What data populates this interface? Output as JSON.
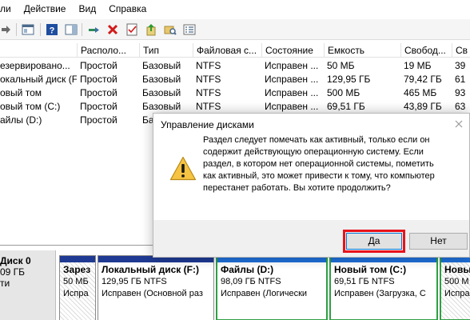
{
  "menu": [
    "Действие",
    "Вид",
    "Справка"
  ],
  "menu_partial": "ли",
  "columns": [
    "Располо...",
    "Тип",
    "Файловая с...",
    "Состояние",
    "Емкость",
    "Свобод...",
    "Св"
  ],
  "volumes": [
    {
      "name": "езервировано...",
      "layout": "Простой",
      "type": "Базовый",
      "fs": "NTFS",
      "status": "Исправен ...",
      "capacity": "50 МБ",
      "free": "19 МБ",
      "pct": "39"
    },
    {
      "name": "окальный диск (F:)",
      "layout": "Простой",
      "type": "Базовый",
      "fs": "NTFS",
      "status": "Исправен ...",
      "capacity": "129,95 ГБ",
      "free": "79,42 ГБ",
      "pct": "61"
    },
    {
      "name": "овый том",
      "layout": "Простой",
      "type": "Базовый",
      "fs": "NTFS",
      "status": "Исправен ...",
      "capacity": "500 МБ",
      "free": "465 МБ",
      "pct": "93"
    },
    {
      "name": "овый том (C:)",
      "layout": "Простой",
      "type": "Базовый",
      "fs": "NTFS",
      "status": "Исправен ...",
      "capacity": "69,51 ГБ",
      "free": "43,89 ГБ",
      "pct": "63"
    },
    {
      "name": "айлы (D:)",
      "layout": "Простой",
      "type": "Ба",
      "fs": "",
      "status": "",
      "capacity": "",
      "free": "",
      "pct": ""
    }
  ],
  "disk": {
    "title": "Диск 0",
    "line2": "09 ГБ",
    "line3": "ти"
  },
  "partitions": [
    {
      "name": "Зарез",
      "size": "50 МБ",
      "status": "Испра"
    },
    {
      "name": "Локальный диск (F:)",
      "size": "129,95 ГБ NTFS",
      "status": "Исправен (Основной раз"
    },
    {
      "name": "Файлы (D:)",
      "size": "98,09 ГБ NTFS",
      "status": "Исправен (Логически"
    },
    {
      "name": "Новый том (C:)",
      "size": "69,51 ГБ NTFS",
      "status": "Исправен (Загрузка, С"
    },
    {
      "name": "Новы",
      "size": "500 М",
      "status": "Испра"
    }
  ],
  "dialog": {
    "title": "Управление дисками",
    "message": [
      "Раздел следует помечать как активный, только если он",
      "содержит действующую операционную систему. Если",
      "раздел, в котором нет операционной системы, пометить",
      "как активный, это может привести к тому, что компьютер",
      "перестанет работать. Вы хотите продолжить?"
    ],
    "yes": "Да",
    "no": "Нет"
  },
  "colors": {
    "accent": "#0078d7",
    "highlight": "#e8121c",
    "primary_bar": "#1f3a93",
    "logical_border": "#2ea043"
  }
}
